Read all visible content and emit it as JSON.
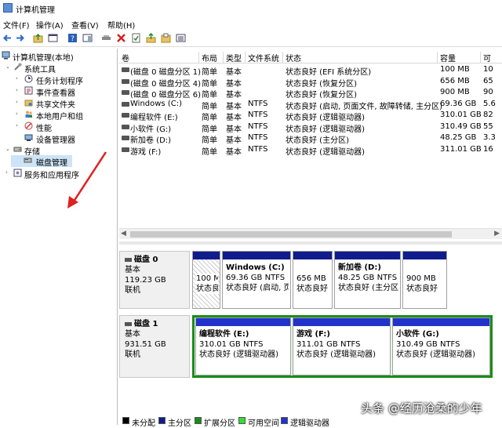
{
  "window": {
    "title": "计算机管理"
  },
  "menu": [
    "文件(F)",
    "操作(A)",
    "查看(V)",
    "帮助(H)"
  ],
  "tree": {
    "root": "计算机管理(本地)",
    "system_tools": "系统工具",
    "task_scheduler": "任务计划程序",
    "event_viewer": "事件查看器",
    "shared_folders": "共享文件夹",
    "local_users": "本地用户和组",
    "performance": "性能",
    "device_manager": "设备管理器",
    "storage": "存储",
    "disk_management": "磁盘管理",
    "services": "服务和应用程序"
  },
  "volume_table": {
    "headers": [
      "卷",
      "布局",
      "类型",
      "文件系统",
      "状态",
      "容量",
      "可"
    ],
    "rows": [
      {
        "vol": "(磁盘 0 磁盘分区 1)",
        "layout": "简单",
        "type": "基本",
        "fs": "",
        "status": "状态良好 (EFI 系统分区)",
        "cap": "100 MB",
        "free": "10"
      },
      {
        "vol": "(磁盘 0 磁盘分区 4)",
        "layout": "简单",
        "type": "基本",
        "fs": "",
        "status": "状态良好 (恢复分区)",
        "cap": "656 MB",
        "free": "65"
      },
      {
        "vol": "(磁盘 0 磁盘分区 6)",
        "layout": "简单",
        "type": "基本",
        "fs": "",
        "status": "状态良好 (恢复分区)",
        "cap": "900 MB",
        "free": "90"
      },
      {
        "vol": "Windows (C:)",
        "layout": "简单",
        "type": "基本",
        "fs": "NTFS",
        "status": "状态良好 (启动, 页面文件, 故障转储, 主分区)",
        "cap": "69.36 GB",
        "free": "5.6"
      },
      {
        "vol": "编程软件 (E:)",
        "layout": "简单",
        "type": "基本",
        "fs": "NTFS",
        "status": "状态良好 (逻辑驱动器)",
        "cap": "310.01 GB",
        "free": "82"
      },
      {
        "vol": "小软件 (G:)",
        "layout": "简单",
        "type": "基本",
        "fs": "NTFS",
        "status": "状态良好 (逻辑驱动器)",
        "cap": "310.49 GB",
        "free": "55"
      },
      {
        "vol": "新加卷 (D:)",
        "layout": "简单",
        "type": "基本",
        "fs": "NTFS",
        "status": "状态良好 (主分区)",
        "cap": "48.25 GB",
        "free": "3.3"
      },
      {
        "vol": "游戏 (F:)",
        "layout": "简单",
        "type": "基本",
        "fs": "NTFS",
        "status": "状态良好 (逻辑驱动器)",
        "cap": "311.01 GB",
        "free": "16"
      }
    ]
  },
  "disk0": {
    "name": "磁盘 0",
    "kind": "基本",
    "size": "119.23 GB",
    "state": "联机",
    "parts": [
      {
        "name": "",
        "size": "100 M",
        "status": "状态良"
      },
      {
        "name": "Windows  (C:)",
        "size": "69.36 GB NTFS",
        "status": "状态良好 (启动, 页"
      },
      {
        "name": "",
        "size": "656 MB",
        "status": "状态良好"
      },
      {
        "name": "新加卷  (D:)",
        "size": "48.25 GB NTFS",
        "status": "状态良好 (主分区)"
      },
      {
        "name": "",
        "size": "900 MB",
        "status": "状态良好"
      }
    ]
  },
  "disk1": {
    "name": "磁盘 1",
    "kind": "基本",
    "size": "931.51 GB",
    "state": "联机",
    "parts": [
      {
        "name": "编程软件  (E:)",
        "size": "310.01 GB NTFS",
        "status": "状态良好 (逻辑驱动器)"
      },
      {
        "name": "游戏  (F:)",
        "size": "311.01 GB NTFS",
        "status": "状态良好 (逻辑驱动器)"
      },
      {
        "name": "小软件  (G:)",
        "size": "310.49 GB NTFS",
        "status": "状态良好 (逻辑驱动器)"
      }
    ]
  },
  "legend": [
    "未分配",
    "主分区",
    "扩展分区",
    "可用空间",
    "逻辑驱动器"
  ],
  "legend_colors": [
    "#000000",
    "#101c8c",
    "#1a8c1a",
    "#33dd33",
    "#2233cc"
  ],
  "watermark": "头条 @经历沧桑的少年"
}
